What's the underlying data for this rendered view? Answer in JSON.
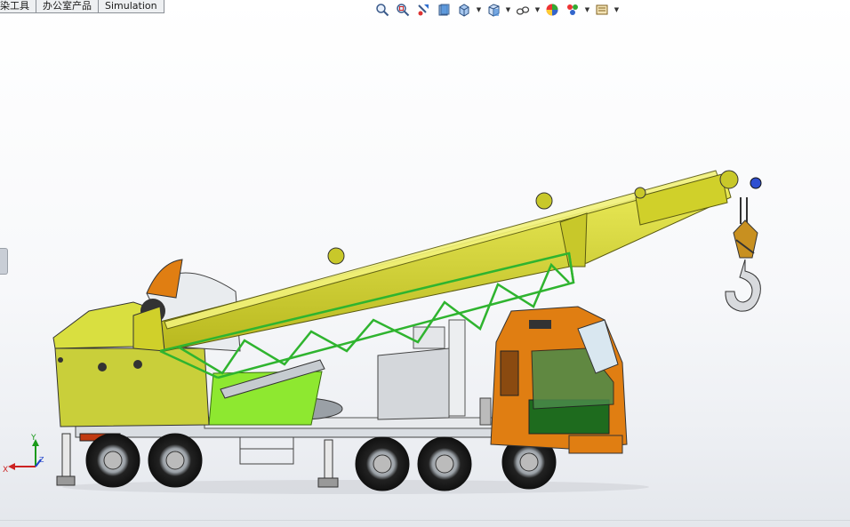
{
  "command_tabs": [
    "染工具",
    "办公室产品",
    "Simulation"
  ],
  "heads_up_toolbar": [
    {
      "icon": "zoom-to-fit-icon",
      "dropdown": false
    },
    {
      "icon": "zoom-to-area-icon",
      "dropdown": false
    },
    {
      "icon": "previous-view-icon",
      "dropdown": false
    },
    {
      "icon": "section-view-icon",
      "dropdown": false
    },
    {
      "icon": "dynamic-annotation-view-icon",
      "dropdown": true
    },
    {
      "icon": "view-orientation-icon",
      "dropdown": true
    },
    {
      "icon": "display-style-icon",
      "dropdown": true
    },
    {
      "icon": "hide-show-items-icon",
      "dropdown": false
    },
    {
      "icon": "edit-appearance-icon",
      "dropdown": true
    },
    {
      "icon": "apply-scene-icon",
      "dropdown": true
    }
  ],
  "triad": {
    "x": "X",
    "y": "Y",
    "z": "Z"
  },
  "colors": {
    "boom": "#d6d62a",
    "lattice": "#2fb42f",
    "cab_orange": "#e07e12",
    "cab_green": "#1e6b1e",
    "platform": "#8ee830"
  }
}
